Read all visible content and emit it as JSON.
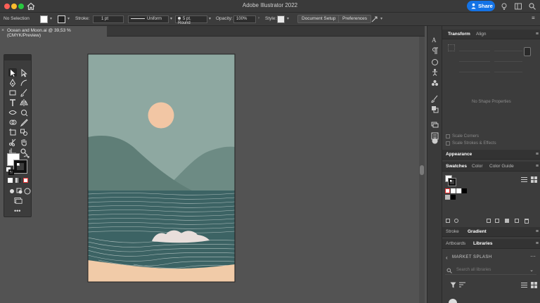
{
  "app": {
    "title": "Adobe Illustrator 2022",
    "share_label": "Share"
  },
  "control_bar": {
    "selection": "No Selection",
    "stroke_label": "Stroke:",
    "stroke_weight": "1 pt",
    "profile": "Uniform",
    "brush": "5 pt. Round",
    "opacity_label": "Opacity:",
    "opacity": "100%",
    "style_label": "Style:",
    "document_setup": "Document Setup",
    "preferences": "Preferences"
  },
  "document": {
    "tab_title": "Ocean and Moon.ai @ 39,53 % (CMYK/Preview)",
    "close": "×"
  },
  "panels": {
    "transform_tabs": [
      "Transform",
      "Align"
    ],
    "no_shape": "No Shape Properties",
    "scale_corners": "Scale Corners",
    "scale_strokes": "Scale Strokes & Effects",
    "appearance": "Appearance",
    "swatch_tabs": [
      "Swatches",
      "Color",
      "Color Guide"
    ],
    "stroke_tabs": [
      "Stroke",
      "Gradient"
    ],
    "lib_tabs": [
      "Artboards",
      "Libraries"
    ],
    "library_name": "MARKET SPLASH",
    "search_placeholder": "Search all libraries",
    "menu_glyph": "≡"
  },
  "colors": {
    "sky": "#8ea8a1",
    "sun": "#f2c6a4",
    "hill_dark": "#5f7e77",
    "hill_light": "#6d8b84",
    "sea": "#3c6364",
    "sand": "#f1cba8",
    "wave": "#e8dedb",
    "accent": "#1473e6"
  }
}
